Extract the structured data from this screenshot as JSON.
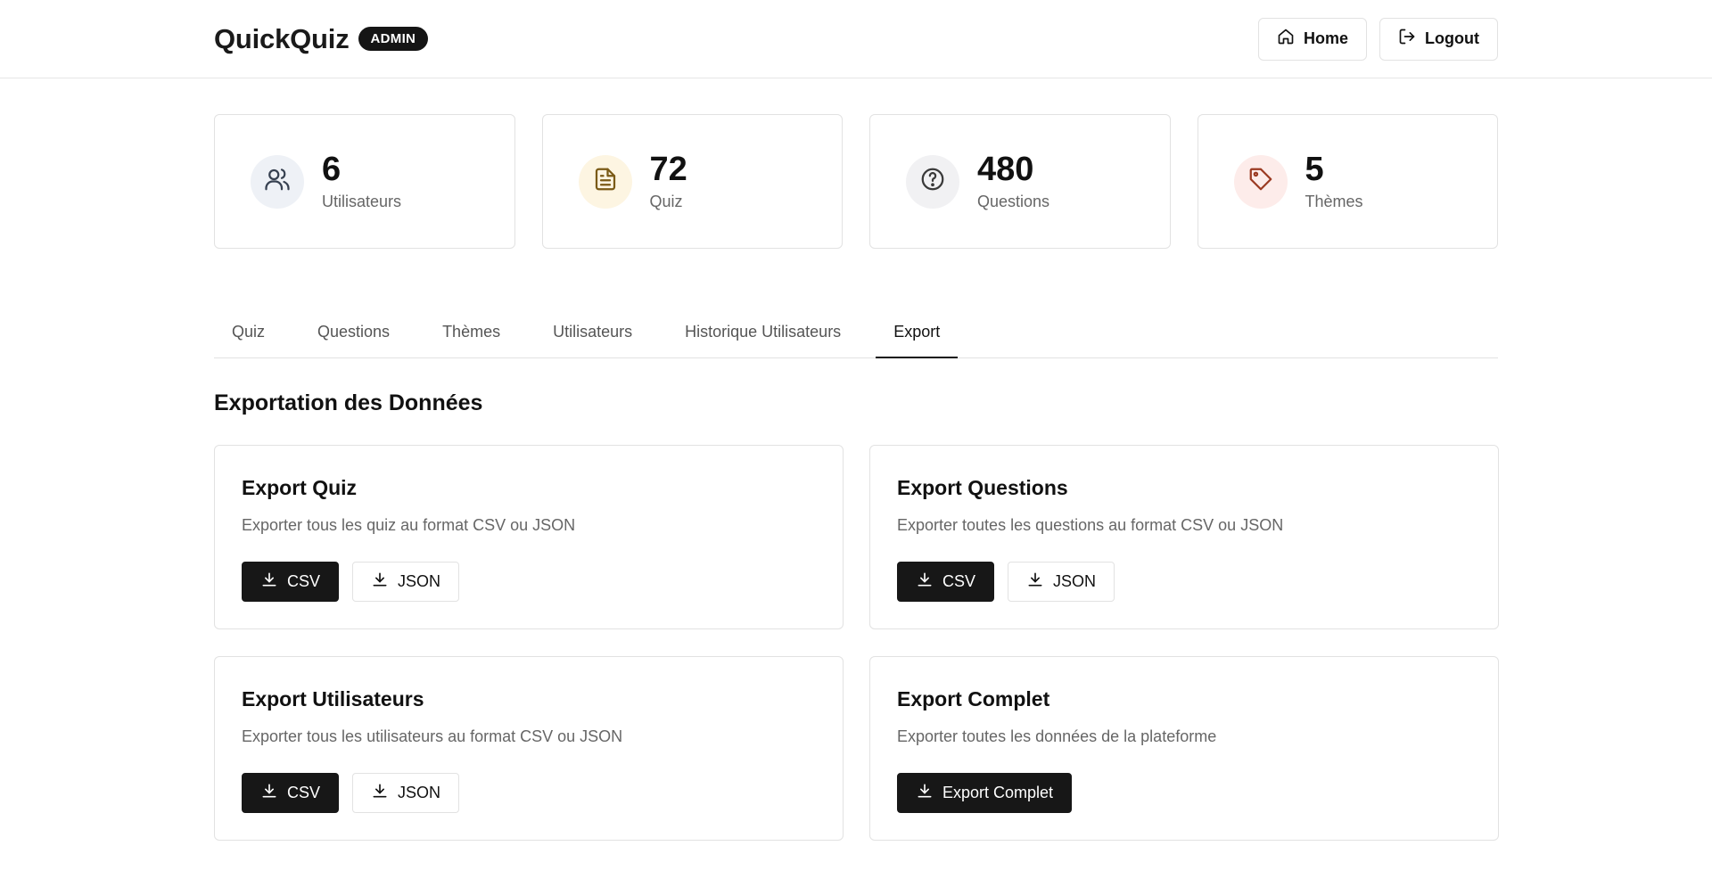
{
  "header": {
    "brand": "QuickQuiz",
    "badge": "ADMIN",
    "home_label": "Home",
    "logout_label": "Logout"
  },
  "stats": [
    {
      "value": "6",
      "label": "Utilisateurs",
      "icon": "users-icon",
      "bg": "#eef1f6",
      "color": "#374151"
    },
    {
      "value": "72",
      "label": "Quiz",
      "icon": "document-icon",
      "bg": "#fdf5e2",
      "color": "#7a5a16"
    },
    {
      "value": "480",
      "label": "Questions",
      "icon": "help-circle-icon",
      "bg": "#f1f1f3",
      "color": "#3a3a3a"
    },
    {
      "value": "5",
      "label": "Thèmes",
      "icon": "tag-icon",
      "bg": "#fdecea",
      "color": "#9b3a22"
    }
  ],
  "tabs": [
    "Quiz",
    "Questions",
    "Thèmes",
    "Utilisateurs",
    "Historique Utilisateurs",
    "Export"
  ],
  "active_tab": "Export",
  "section_title": "Exportation des Données",
  "cards": [
    {
      "title": "Export Quiz",
      "desc": "Exporter tous les quiz au format CSV ou JSON",
      "csv": "CSV",
      "json": "JSON"
    },
    {
      "title": "Export Questions",
      "desc": "Exporter toutes les questions au format CSV ou JSON",
      "csv": "CSV",
      "json": "JSON"
    },
    {
      "title": "Export Utilisateurs",
      "desc": "Exporter tous les utilisateurs au format CSV ou JSON",
      "csv": "CSV",
      "json": "JSON"
    },
    {
      "title": "Export Complet",
      "desc": "Exporter toutes les données de la plateforme",
      "full": "Export Complet"
    }
  ]
}
